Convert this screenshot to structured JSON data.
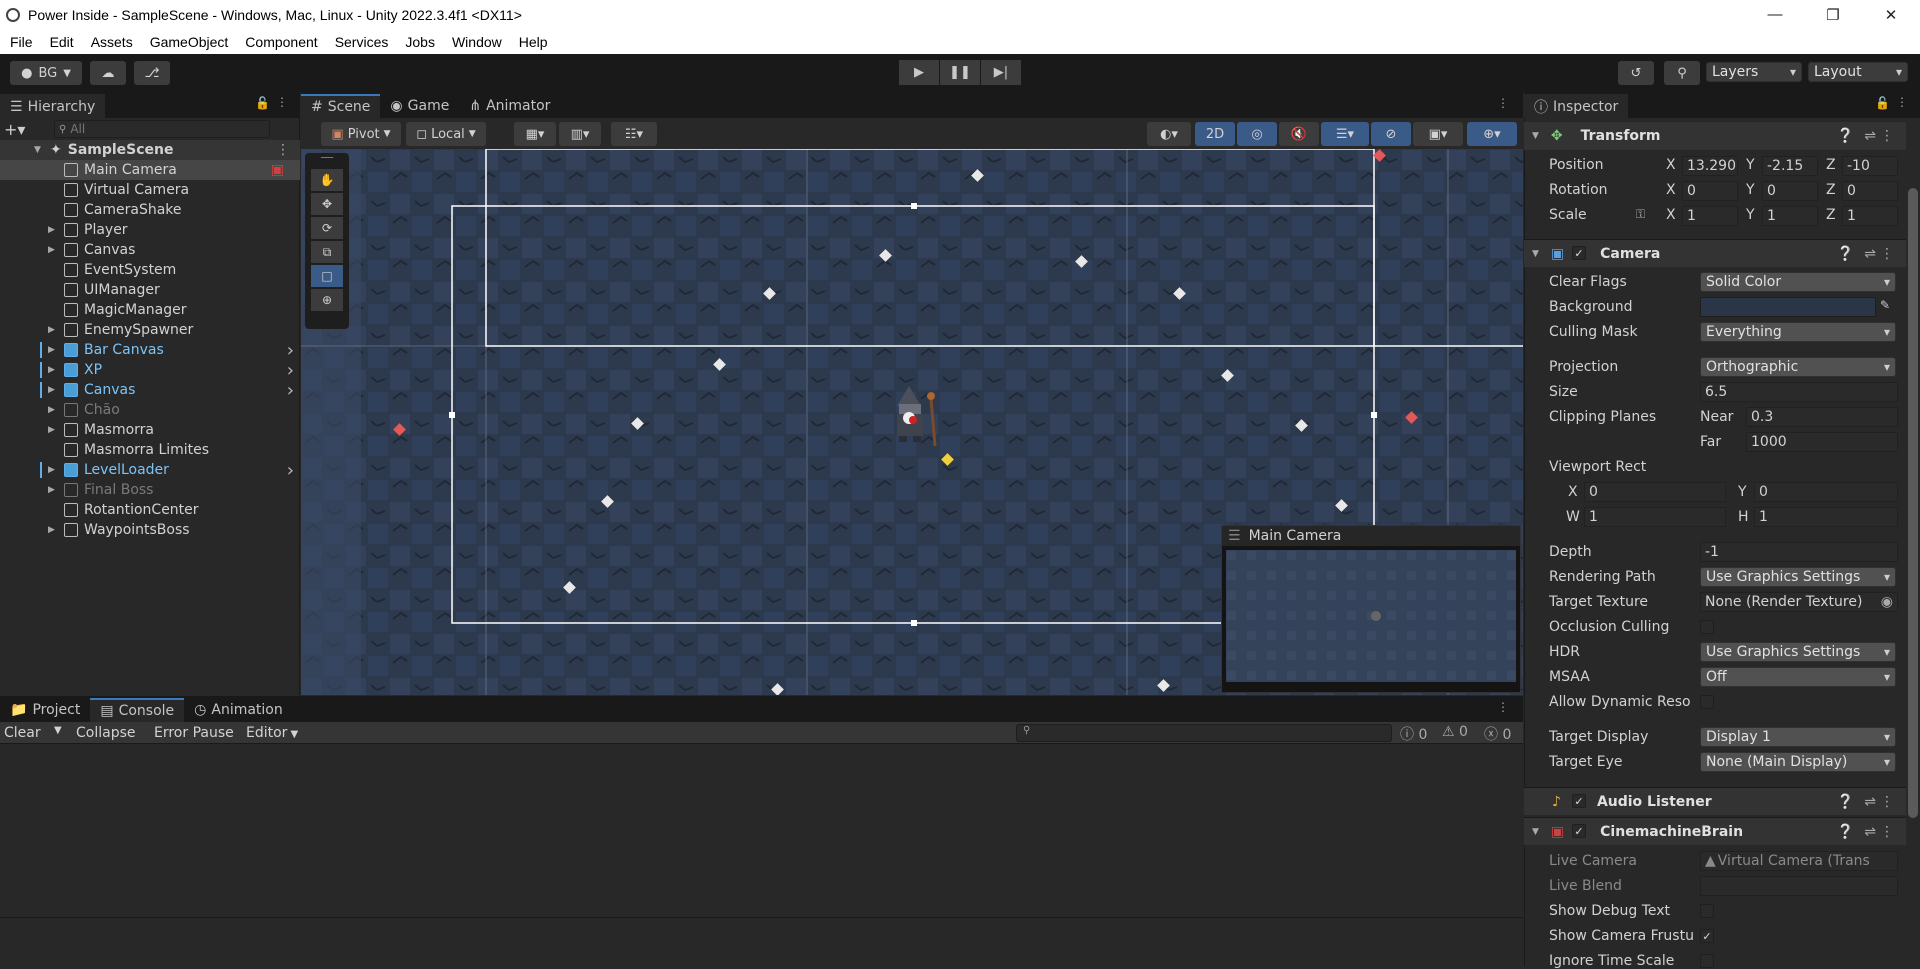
{
  "window": {
    "title": "Power Inside - SampleScene - Windows, Mac, Linux - Unity 2022.3.4f1 <DX11>"
  },
  "menu": [
    "File",
    "Edit",
    "Assets",
    "GameObject",
    "Component",
    "Services",
    "Jobs",
    "Window",
    "Help"
  ],
  "toolbar": {
    "account": "BG",
    "layers": "Layers",
    "layout": "Layout"
  },
  "hierarchy": {
    "tab": "Hierarchy",
    "search_placeholder": "All",
    "scene": "SampleScene",
    "items": [
      {
        "label": "Main Camera",
        "style": "normal",
        "expand": false,
        "selected": true
      },
      {
        "label": "Virtual Camera",
        "style": "normal",
        "expand": false
      },
      {
        "label": "CameraShake",
        "style": "normal",
        "expand": false
      },
      {
        "label": "Player",
        "style": "normal",
        "expand": true
      },
      {
        "label": "Canvas",
        "style": "normal",
        "expand": true
      },
      {
        "label": "EventSystem",
        "style": "normal",
        "expand": false
      },
      {
        "label": "UIManager",
        "style": "normal",
        "expand": false
      },
      {
        "label": "MagicManager",
        "style": "normal",
        "expand": false
      },
      {
        "label": "EnemySpawner",
        "style": "normal",
        "expand": true
      },
      {
        "label": "Bar Canvas",
        "style": "prefab",
        "expand": true
      },
      {
        "label": "XP",
        "style": "prefab",
        "expand": true
      },
      {
        "label": "Canvas",
        "style": "prefab",
        "expand": true
      },
      {
        "label": "Chão",
        "style": "disabled",
        "expand": true
      },
      {
        "label": "Masmorra",
        "style": "normal",
        "expand": true
      },
      {
        "label": "Masmorra Limites",
        "style": "normal",
        "expand": false
      },
      {
        "label": "LevelLoader",
        "style": "prefab",
        "expand": true
      },
      {
        "label": "Final Boss",
        "style": "disabled",
        "expand": true
      },
      {
        "label": "RotantionCenter",
        "style": "normal",
        "expand": false
      },
      {
        "label": "WaypointsBoss",
        "style": "normal",
        "expand": true
      }
    ]
  },
  "scene_tabs": [
    "Scene",
    "Game",
    "Animator"
  ],
  "scene_toolbar": {
    "pivot": "Pivot",
    "local": "Local",
    "mode2d": "2D"
  },
  "camera_preview": {
    "title": "Main Camera"
  },
  "bottom_tabs": [
    "Project",
    "Console",
    "Animation"
  ],
  "console": {
    "clear": "Clear",
    "collapse": "Collapse",
    "error_pause": "Error Pause",
    "editor": "Editor",
    "count_log": "0",
    "count_warn": "0",
    "count_error": "0"
  },
  "inspector": {
    "tab": "Inspector",
    "transform": {
      "title": "Transform",
      "position_label": "Position",
      "rotation_label": "Rotation",
      "scale_label": "Scale",
      "px": "13.290",
      "py": "-2.15",
      "pz": "-10",
      "rx": "0",
      "ry": "0",
      "rz": "0",
      "sx": "1",
      "sy": "1",
      "sz": "1",
      "axis_x": "X",
      "axis_y": "Y",
      "axis_z": "Z"
    },
    "camera": {
      "title": "Camera",
      "clear_flags_label": "Clear Flags",
      "clear_flags": "Solid Color",
      "background_label": "Background",
      "culling_mask_label": "Culling Mask",
      "culling_mask": "Everything",
      "projection_label": "Projection",
      "projection": "Orthographic",
      "size_label": "Size",
      "size": "6.5",
      "clipping_label": "Clipping Planes",
      "near_label": "Near",
      "near": "0.3",
      "far_label": "Far",
      "far": "1000",
      "viewport_label": "Viewport Rect",
      "vx": "0",
      "vy": "0",
      "vw": "1",
      "vh": "1",
      "x_label": "X",
      "y_label": "Y",
      "w_label": "W",
      "h_label": "H",
      "depth_label": "Depth",
      "depth": "-1",
      "rendering_path_label": "Rendering Path",
      "rendering_path": "Use Graphics Settings",
      "target_texture_label": "Target Texture",
      "target_texture": "None (Render Texture)",
      "occlusion_label": "Occlusion Culling",
      "hdr_label": "HDR",
      "hdr": "Use Graphics Settings",
      "msaa_label": "MSAA",
      "msaa": "Off",
      "dynamic_res_label": "Allow Dynamic Reso",
      "target_display_label": "Target Display",
      "target_display": "Display 1",
      "target_eye_label": "Target Eye",
      "target_eye": "None (Main Display)",
      "background_color": "#2a3648"
    },
    "audio_listener": {
      "title": "Audio Listener"
    },
    "cinemachine": {
      "title": "CinemachineBrain",
      "live_camera_label": "Live Camera",
      "live_camera": "Virtual Camera (Trans",
      "live_blend_label": "Live Blend",
      "debug_text_label": "Show Debug Text",
      "frustum_label": "Show Camera Frustu",
      "ignore_time_label": "Ignore Time Scale"
    }
  }
}
